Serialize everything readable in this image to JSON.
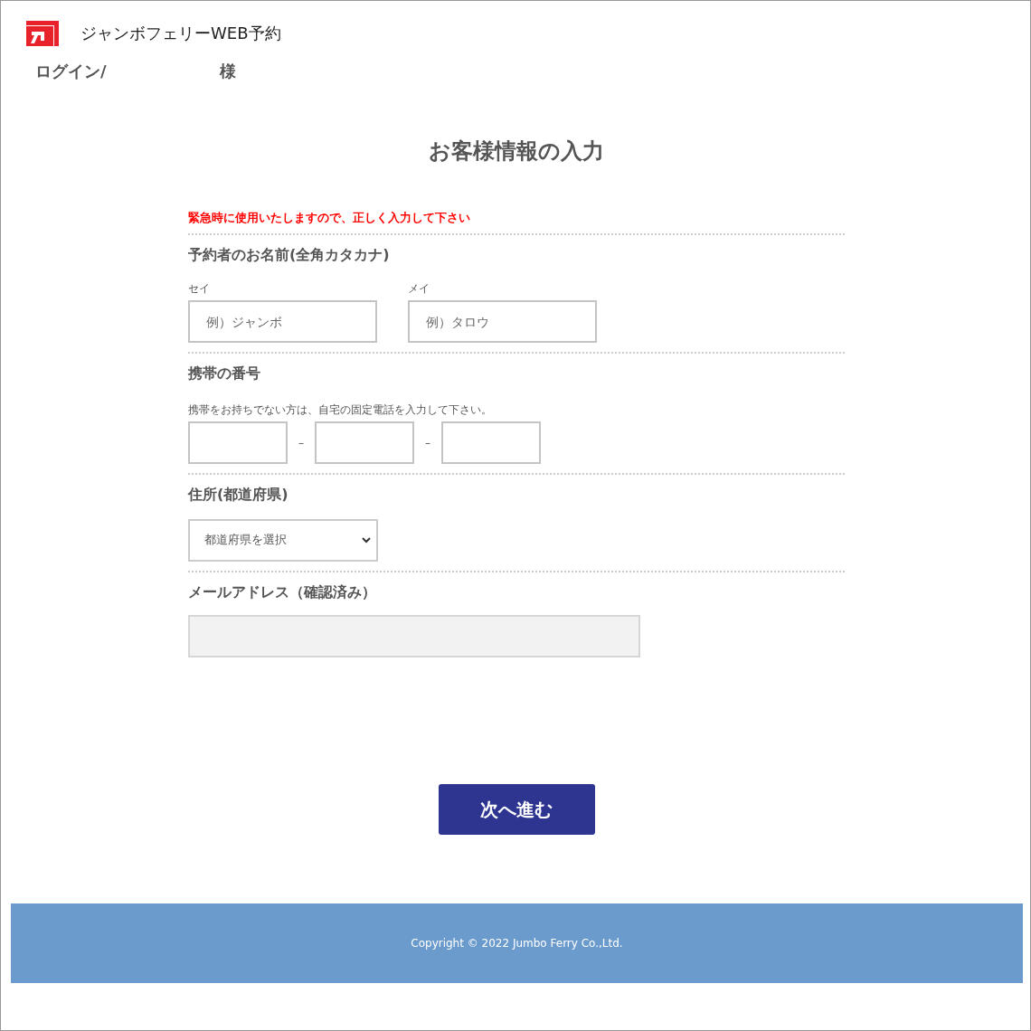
{
  "header": {
    "site_title": "ジャンボフェリーWEB予約",
    "login_label": "ログイン/",
    "user_suffix": "様"
  },
  "page_title": "お客様情報の入力",
  "notice": "緊急時に使用いたしますので、正しく入力して下さい",
  "sections": [
    {
      "kind": "name",
      "title": "予約者のお名前(全角カタカナ)",
      "fields": [
        {
          "label": "セイ",
          "placeholder": "例）ジャンボ"
        },
        {
          "label": "メイ",
          "placeholder": "例）タロウ"
        }
      ]
    },
    {
      "kind": "phone",
      "title": "携帯の番号",
      "hint": "携帯をお持ちでない方は、自宅の固定電話を入力して下さい。",
      "separators": [
        "–",
        "–"
      ]
    },
    {
      "kind": "select",
      "title": "住所(都道府県)",
      "value": "都道府県を選択"
    },
    {
      "kind": "email",
      "title": "メールアドレス（確認済み）",
      "disabled": true
    }
  ],
  "next_button": "次へ進む",
  "footer": {
    "copyright": "Copyright © 2022 Jumbo Ferry Co.,Ltd."
  }
}
